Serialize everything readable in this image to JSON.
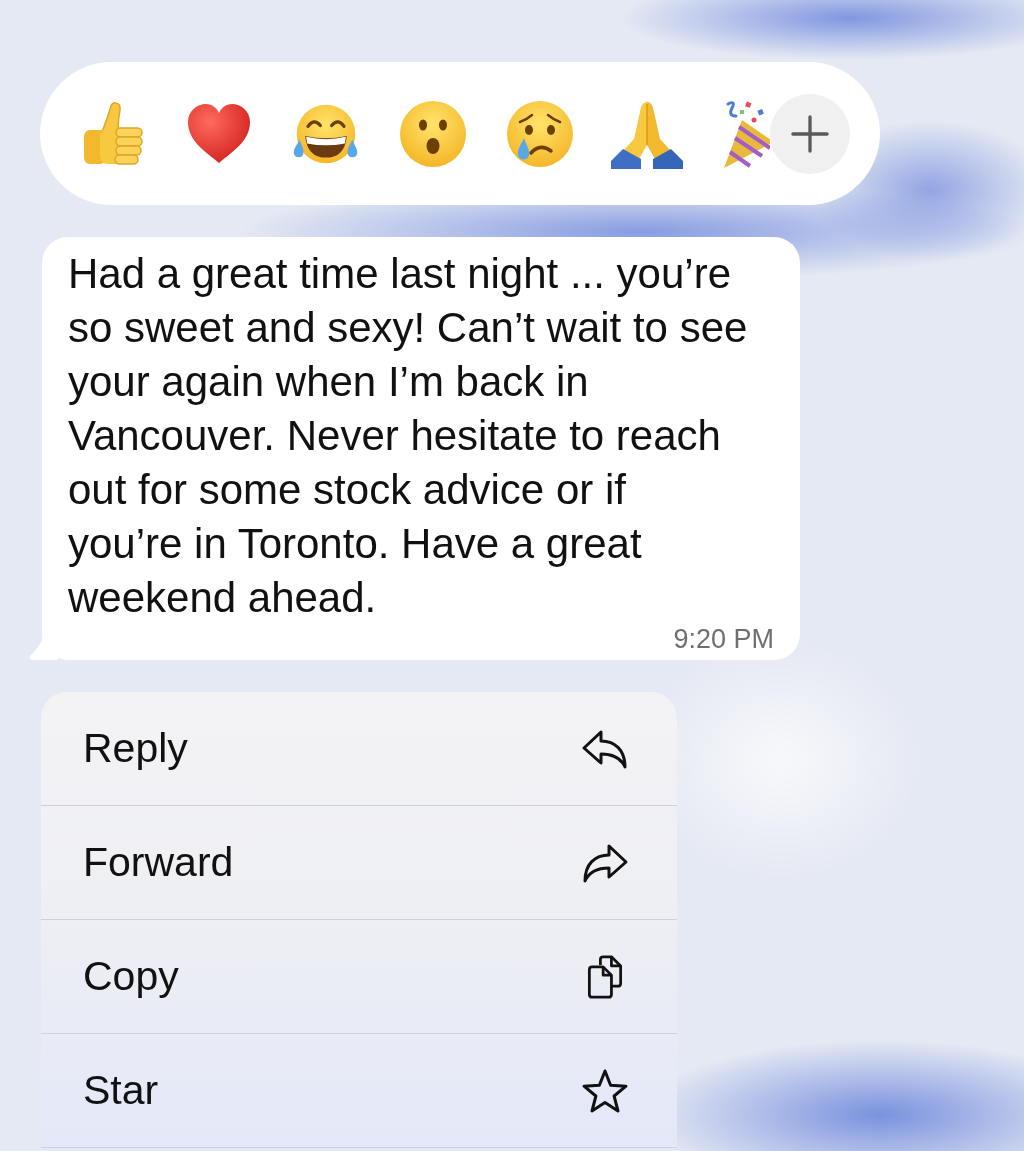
{
  "reactions": [
    {
      "kind": "thumbs_up"
    },
    {
      "kind": "heart"
    },
    {
      "kind": "laughing"
    },
    {
      "kind": "surprised"
    },
    {
      "kind": "crying"
    },
    {
      "kind": "folded_hands"
    },
    {
      "kind": "party_popper"
    }
  ],
  "message": {
    "text": "Had a great time last night ... you’re\nso sweet and sexy! Can’t wait to see\nyour again when I’m back in\nVancouver. Never hesitate to reach\nout for some stock advice or if\nyou’re in Toronto. Have a great\nweekend ahead.",
    "time": "9:20 PM"
  },
  "menu": [
    {
      "label": "Reply",
      "kind": "reply"
    },
    {
      "label": "Forward",
      "kind": "forward"
    },
    {
      "label": "Copy",
      "kind": "copy"
    },
    {
      "label": "Star",
      "kind": "star"
    }
  ]
}
